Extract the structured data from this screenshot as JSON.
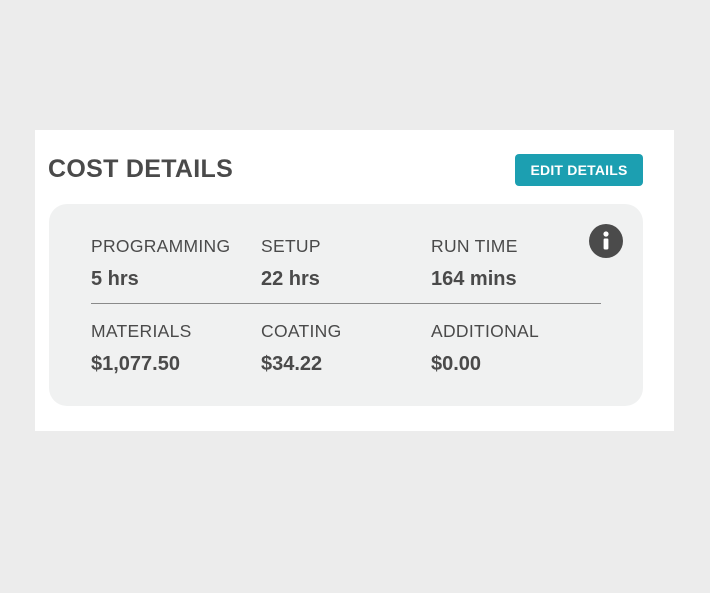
{
  "card": {
    "title": "COST DETAILS",
    "edit_label": "EDIT DETAILS",
    "info_icon": "info-icon",
    "colors": {
      "accent": "#1c9fb1",
      "text": "#4a4a4a",
      "panel_bg": "#f0f1f1"
    },
    "rows": [
      [
        {
          "label": "PROGRAMMING",
          "value": "5 hrs"
        },
        {
          "label": "SETUP",
          "value": "22 hrs"
        },
        {
          "label": "RUN TIME",
          "value": "164 mins"
        }
      ],
      [
        {
          "label": "MATERIALS",
          "value": "$1,077.50"
        },
        {
          "label": "COATING",
          "value": "$34.22"
        },
        {
          "label": "ADDITIONAL",
          "value": "$0.00"
        }
      ]
    ]
  }
}
